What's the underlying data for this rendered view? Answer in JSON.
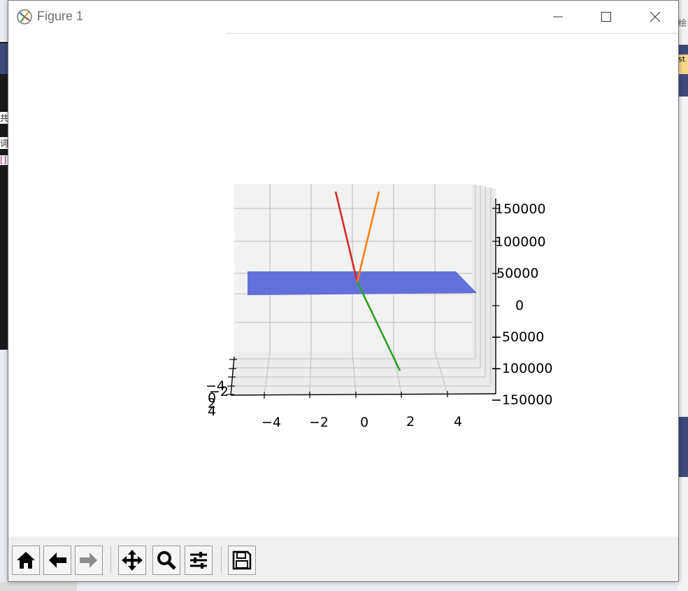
{
  "window": {
    "title": "Figure 1"
  },
  "background": {
    "right_text": "绘",
    "right_badge": "st",
    "left_glyphs": [
      "共",
      "词",
      "[]"
    ]
  },
  "toolbar": {
    "buttons": [
      {
        "name": "home-button",
        "icon": "home-icon"
      },
      {
        "name": "back-button",
        "icon": "arrow-left-icon"
      },
      {
        "name": "forward-button",
        "icon": "arrow-right-icon"
      },
      {
        "name": "pan-button",
        "icon": "move-icon"
      },
      {
        "name": "zoom-button",
        "icon": "magnifier-icon"
      },
      {
        "name": "configure-subplots-button",
        "icon": "sliders-icon"
      },
      {
        "name": "save-button",
        "icon": "floppy-icon"
      }
    ]
  },
  "chart_data": {
    "type": "3d-surface-with-lines",
    "title": "",
    "x_ticks": [
      "−4",
      "−2",
      "0",
      "2",
      "4"
    ],
    "y_ticks": [
      "−4",
      "−2",
      "0",
      "2",
      "4"
    ],
    "z_ticks": [
      "150000",
      "100000",
      "50000",
      "0",
      "−50000",
      "−100000",
      "−150000"
    ],
    "zlim": [
      -150000,
      150000
    ],
    "grid": true,
    "surface": {
      "color": "#5a69d8",
      "z_level": 0
    },
    "lines": [
      {
        "color": "#d62728",
        "from_z": 0,
        "to_z": 160000
      },
      {
        "color": "#ff7f0e",
        "from_z": 0,
        "to_z": 160000
      },
      {
        "color": "#2ca02c",
        "from_z": 0,
        "to_z": -150000
      }
    ]
  }
}
